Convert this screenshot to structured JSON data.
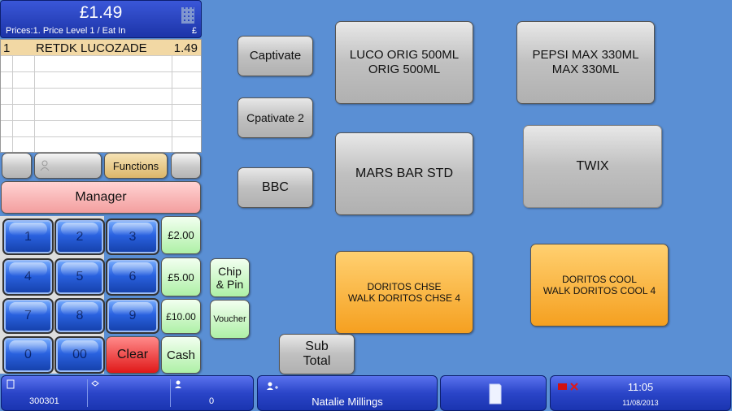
{
  "header": {
    "total": "£1.49",
    "prices_label": "Prices:1. Price Level 1 / Eat In",
    "currency": "£"
  },
  "order": {
    "items": [
      {
        "qty": "1",
        "description": "RETDK LUCOZADE",
        "price": "1.49"
      }
    ]
  },
  "controls": {
    "functions_label": "Functions",
    "manager_label": "Manager"
  },
  "numpad": {
    "keys": [
      "1",
      "2",
      "3",
      "4",
      "5",
      "6",
      "7",
      "8",
      "9",
      "0",
      "00"
    ],
    "clear_label": "Clear"
  },
  "tender": {
    "two_pounds": "£2.00",
    "five_pounds": "£5.00",
    "ten_pounds": "£10.00",
    "cash": "Cash",
    "chip_pin_line1": "Chip",
    "chip_pin_line2": "& Pin",
    "voucher": "Voucher",
    "subtotal_line1": "Sub",
    "subtotal_line2": "Total"
  },
  "categories": {
    "captivate": "Captivate",
    "cpativate2": "Cpativate 2",
    "bbc": "BBC"
  },
  "products": {
    "luco_line1": "LUCO ORIG 500ML",
    "luco_line2": "ORIG 500ML",
    "pepsi_line1": "PEPSI MAX 330ML",
    "pepsi_line2": "MAX 330ML",
    "mars": "MARS BAR STD",
    "twix": "TWIX",
    "doritos_chse_line1": "DORITOS CHSE",
    "doritos_chse_line2": "WALK DORITOS CHSE 4",
    "doritos_cool_line1": "DORITOS COOL",
    "doritos_cool_line2": "WALK DORITOS COOL 4"
  },
  "status_bar": {
    "terminal_id": "300301",
    "count": "0",
    "operator_name": "Natalie Millings",
    "time": "11:05",
    "date": "11/08/2013"
  },
  "icons": {
    "calculator": "calculator-icon",
    "user": "user-icon",
    "receipt": "receipt-icon",
    "printer_error": "printer-error-icon"
  },
  "colors": {
    "background": "#5a8fd4",
    "selected_row": "#f2d8a4",
    "clear_button": "#e01818",
    "promo_button": "#f5a020"
  }
}
